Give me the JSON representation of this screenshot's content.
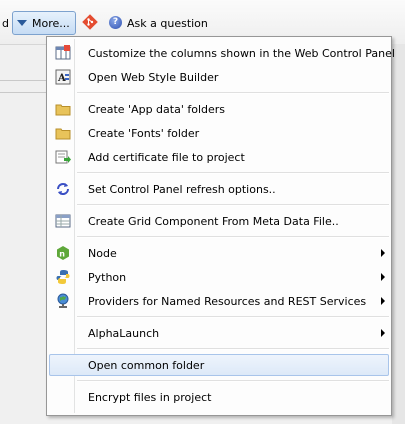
{
  "toolbar": {
    "cut_label": "d",
    "more_label": "More...",
    "ask_label": "Ask a question"
  },
  "menu": {
    "items": [
      {
        "label": "Customize the columns shown in the Web Control Panel",
        "icon": "columns-icon"
      },
      {
        "label": "Open Web Style Builder",
        "icon": "style-builder-icon"
      },
      {
        "label": "Create 'App data' folders",
        "icon": "folder-icon"
      },
      {
        "label": "Create 'Fonts' folder",
        "icon": "folder-icon"
      },
      {
        "label": "Add certificate file to project",
        "icon": "certificate-icon"
      },
      {
        "label": "Set Control Panel refresh options..",
        "icon": "refresh-icon"
      },
      {
        "label": "Create Grid Component From Meta Data File..",
        "icon": "grid-icon"
      },
      {
        "label": "Node",
        "icon": "node-icon",
        "submenu": true
      },
      {
        "label": "Python",
        "icon": "python-icon",
        "submenu": true
      },
      {
        "label": "Providers for Named Resources and REST Services",
        "icon": "globe-icon",
        "submenu": true
      },
      {
        "label": "AlphaLaunch",
        "submenu": true
      },
      {
        "label": "Open common folder",
        "highlighted": true
      },
      {
        "label": "Encrypt files in project"
      }
    ]
  },
  "colors": {
    "highlight": "#dde9f8",
    "more_button": "#c6dcf4",
    "folder": "#e8c35a",
    "git": "#e44c30"
  }
}
